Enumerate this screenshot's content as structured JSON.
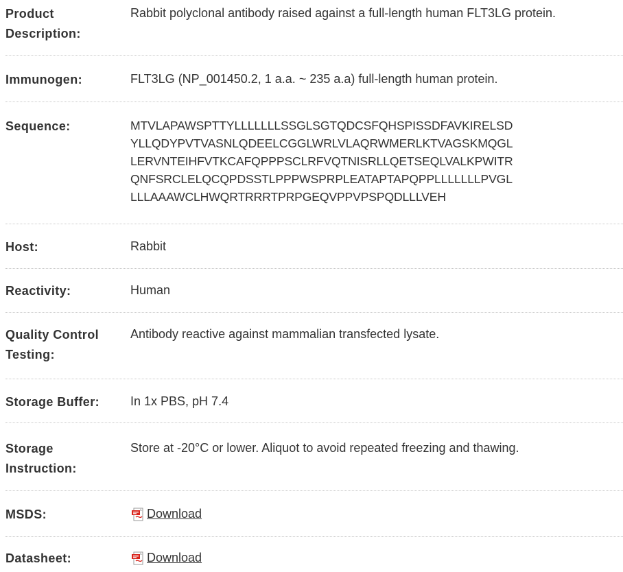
{
  "rows": [
    {
      "key": "product_description",
      "label": "Product Description:",
      "value": "Rabbit polyclonal antibody raised against a full-length human FLT3LG protein."
    },
    {
      "key": "immunogen",
      "label": "Immunogen:",
      "value": "FLT3LG (NP_001450.2, 1 a.a. ~ 235 a.a) full-length human protein."
    },
    {
      "key": "sequence",
      "label": "Sequence:",
      "lines": [
        "MTVLAPAWSPTTYLLLLLLLSSGLSGTQDCSFQHSPISSDFAVKIRELSD",
        "YLLQDYPVTVASNLQDEELCGGLWRLVLAQRWMERLKTVAGSKMQGL",
        "LERVNTEIHFVTKCAFQPPPSCLRFVQTNISRLLQETSEQLVALKPWITR",
        "QNFSRCLELQCQPDSSTLPPPWSPRPLEATAPTAPQPPLLLLLLLPVGL",
        "LLLAAAWCLHWQRTRRRTPRPGEQVPPVPSPQDLLLVEH"
      ]
    },
    {
      "key": "host",
      "label": "Host:",
      "value": "Rabbit"
    },
    {
      "key": "reactivity",
      "label": "Reactivity:",
      "value": "Human"
    },
    {
      "key": "qc_testing",
      "label": "Quality Control Testing:",
      "value": "Antibody reactive against mammalian transfected lysate."
    },
    {
      "key": "storage_buffer",
      "label": "Storage Buffer:",
      "value": "In 1x PBS, pH 7.4"
    },
    {
      "key": "storage_instruction",
      "label": "Storage Instruction:",
      "value": "Store at -20°C or lower. Aliquot to avoid repeated freezing and thawing."
    },
    {
      "key": "msds",
      "label": "MSDS:",
      "link_label": "Download",
      "icon": "pdf-icon"
    },
    {
      "key": "datasheet",
      "label": "Datasheet:",
      "link_label": "Download",
      "icon": "pdf-icon"
    }
  ],
  "colors": {
    "text": "#333333",
    "divider": "#c8c8c8",
    "pdf_red": "#d9241c"
  }
}
